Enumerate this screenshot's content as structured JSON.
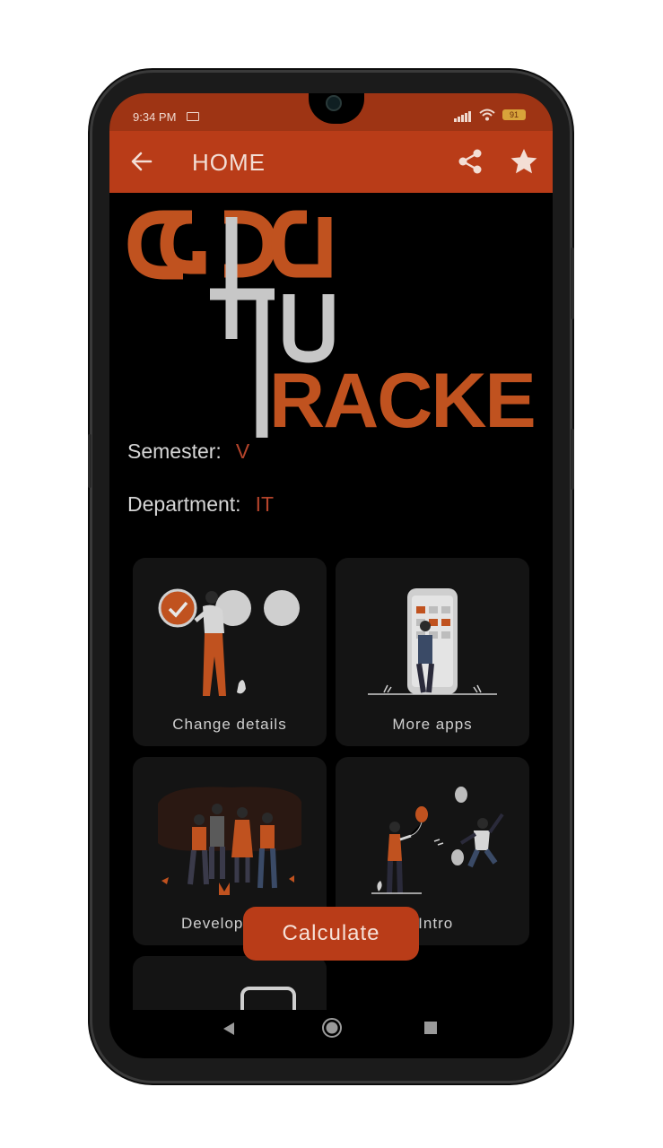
{
  "status_bar": {
    "time": "9:34 PM",
    "battery": "91"
  },
  "app_bar": {
    "title": "HOME",
    "back_icon": "arrow-left-icon",
    "share_icon": "share-icon",
    "star_icon": "star-icon"
  },
  "logo": {
    "text": "CGPA TU TRACKER"
  },
  "info": {
    "semester_label": "Semester:",
    "semester_value": "V",
    "department_label": "Department:",
    "department_value": "IT"
  },
  "cards": [
    {
      "label": "Change details",
      "icon": "checklist-illustration"
    },
    {
      "label": "More apps",
      "icon": "phone-apps-illustration"
    },
    {
      "label": "Develop",
      "icon": "team-illustration"
    },
    {
      "label": "o Intro",
      "icon": "celebration-illustration"
    }
  ],
  "fab": {
    "label": "Calculate"
  },
  "colors": {
    "accent": "#b93c18",
    "status_bar": "#9e3414",
    "background": "#000000",
    "card": "#141414",
    "value_text": "#b5442b"
  }
}
